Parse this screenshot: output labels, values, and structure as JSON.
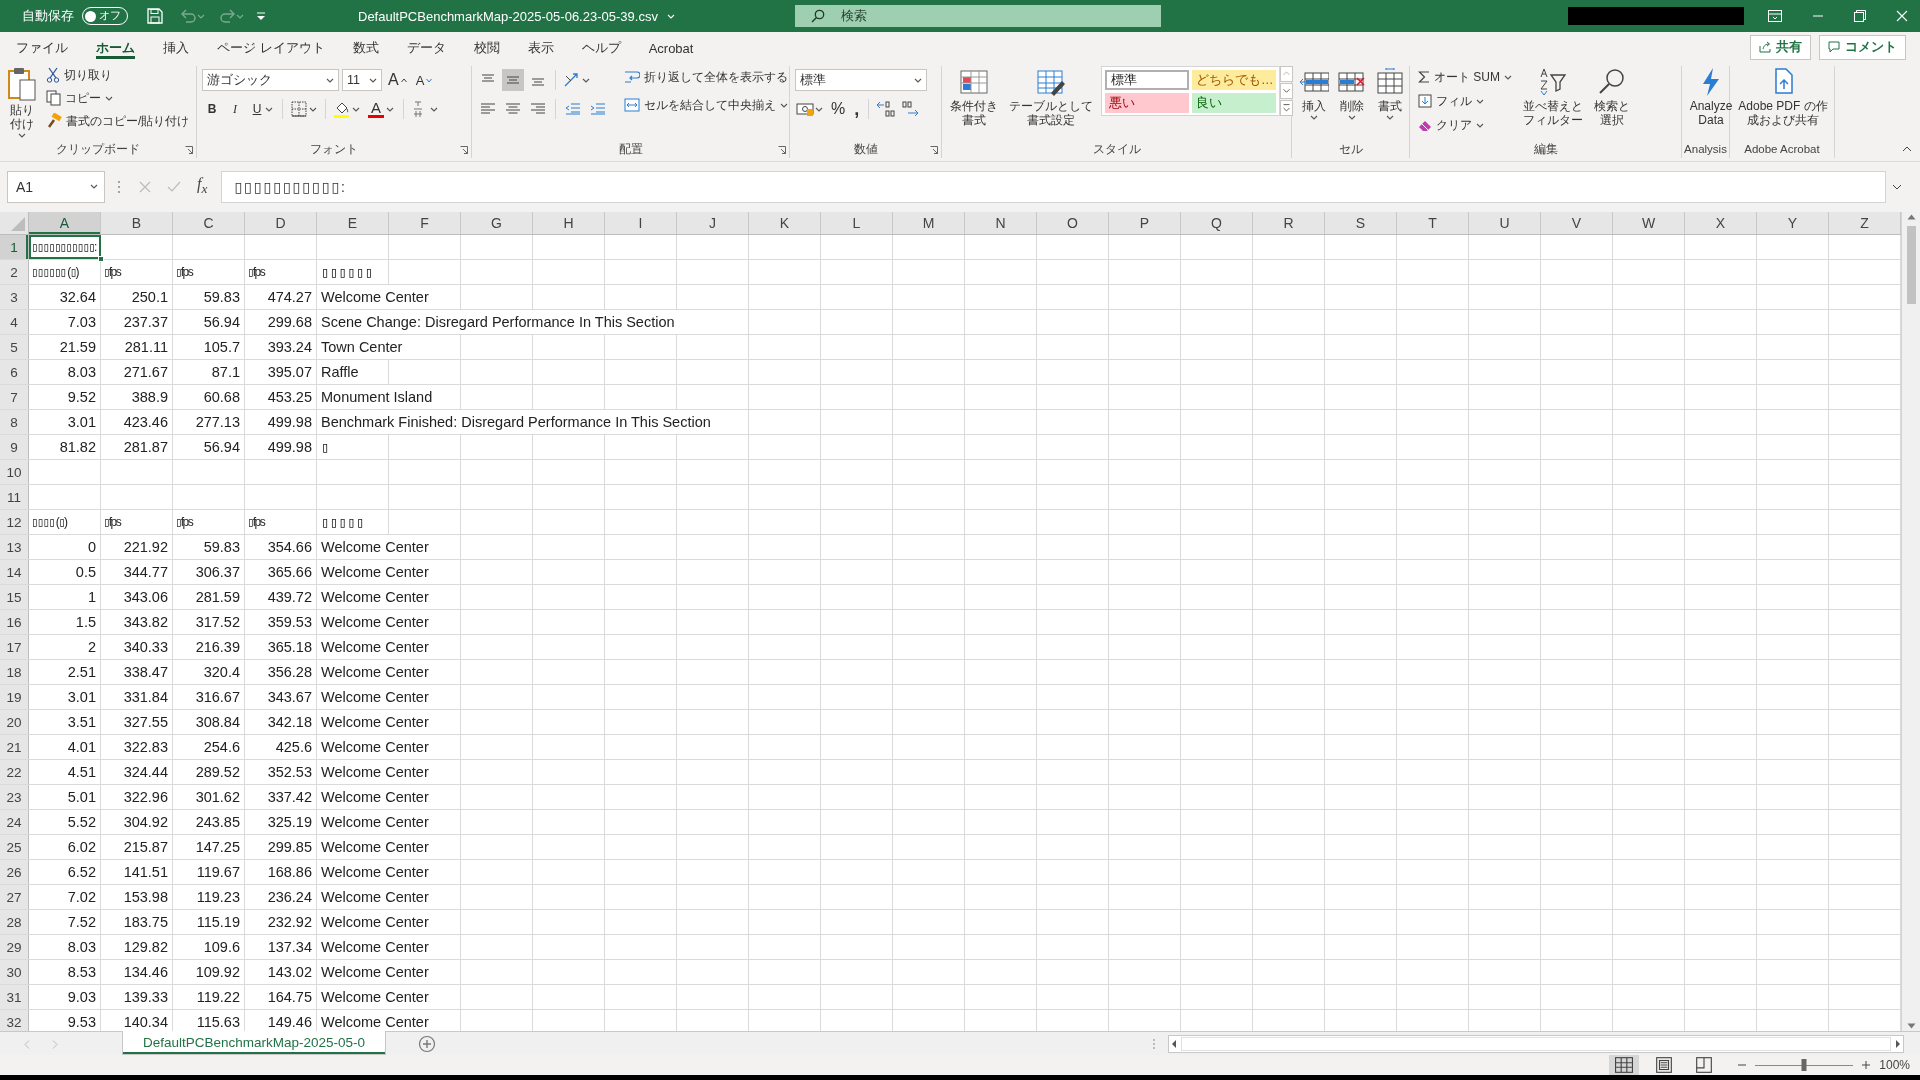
{
  "title_bar": {
    "autosave_label": "自動保存",
    "autosave": {
      "label": "オフ",
      "on": false
    },
    "undo": {
      "disabled": true
    },
    "redo": {
      "disabled": true
    },
    "filename": "DefaultPCBenchmarkMap-2025-05-06.23-05-39.csv",
    "search": {
      "placeholder": "検索"
    }
  },
  "menu_tabs": [
    {
      "label": "ファイル",
      "selected": false
    },
    {
      "label": "ホーム",
      "selected": true
    },
    {
      "label": "挿入",
      "selected": false
    },
    {
      "label": "ページ レイアウト",
      "selected": false
    },
    {
      "label": "数式",
      "selected": false
    },
    {
      "label": "データ",
      "selected": false
    },
    {
      "label": "校閲",
      "selected": false
    },
    {
      "label": "表示",
      "selected": false
    },
    {
      "label": "ヘルプ",
      "selected": false
    },
    {
      "label": "Acrobat",
      "selected": false
    }
  ],
  "share_button": "共有",
  "comment_button": "コメント",
  "ribbon": {
    "clipboard": {
      "paste": "貼り付け",
      "cut": "切り取り",
      "copy": "コピー",
      "format_painter": "書式のコピー/貼り付け",
      "label": "クリップボード"
    },
    "font": {
      "font_name": "游ゴシック",
      "font_size": "11",
      "grow": "A",
      "shrink": "A",
      "bold": "B",
      "italic": "I",
      "underline": "U",
      "font_color": "A",
      "label": "フォント"
    },
    "alignment": {
      "vertical_align": [
        {
          "selected": false
        },
        {
          "selected": true
        },
        {
          "selected": false
        }
      ],
      "wrap_text": "折り返して全体を表示する",
      "merge_center": "セルを結合して中央揃え",
      "label": "配置"
    },
    "number": {
      "format": "標準",
      "percent": "%",
      "comma": ",",
      "label": "数値"
    },
    "styles": {
      "conditional": "条件付き書式",
      "format_table": "テーブルとして書式設定",
      "cell_styles": [
        {
          "label": "標準",
          "kind": "normal"
        },
        {
          "label": "どちらでも…",
          "kind": "neutral"
        },
        {
          "label": "悪い",
          "kind": "bad"
        },
        {
          "label": "良い",
          "kind": "good"
        }
      ],
      "label": "スタイル"
    },
    "cells": {
      "insert": "挿入",
      "delete": "削除",
      "format": "書式",
      "label": "セル"
    },
    "editing": {
      "autosum": "オート SUM",
      "fill": "フィル",
      "clear": "クリア",
      "sort_filter": "並べ替えとフィルター",
      "find_select": "検索と選択",
      "label": "編集"
    },
    "analysis": {
      "analyze_data": "Analyze Data",
      "label": "Analysis"
    },
    "acrobat": {
      "create_share": "Adobe PDF の作成および共有",
      "label": "Adobe Acrobat"
    }
  },
  "formula_bar": {
    "name_box": "A1",
    "function_button": "f$_{x}$",
    "formula": "▯▯▯▯▯▯▯▯▯▯▯:"
  },
  "grid": {
    "columns": [
      {
        "label": "A",
        "selected": true
      },
      {
        "label": "B",
        "selected": false
      },
      {
        "label": "C",
        "selected": false
      },
      {
        "label": "D",
        "selected": false
      },
      {
        "label": "E",
        "selected": false
      },
      {
        "label": "F",
        "selected": false
      },
      {
        "label": "G",
        "selected": false
      },
      {
        "label": "H",
        "selected": false
      },
      {
        "label": "I",
        "selected": false
      },
      {
        "label": "J",
        "selected": false
      },
      {
        "label": "K",
        "selected": false
      },
      {
        "label": "L",
        "selected": false
      },
      {
        "label": "M",
        "selected": false
      },
      {
        "label": "N",
        "selected": false
      },
      {
        "label": "O",
        "selected": false
      },
      {
        "label": "P",
        "selected": false
      },
      {
        "label": "Q",
        "selected": false
      },
      {
        "label": "R",
        "selected": false
      },
      {
        "label": "S",
        "selected": false
      },
      {
        "label": "T",
        "selected": false
      },
      {
        "label": "U",
        "selected": false
      },
      {
        "label": "V",
        "selected": false
      },
      {
        "label": "W",
        "selected": false
      },
      {
        "label": "X",
        "selected": false
      },
      {
        "label": "Y",
        "selected": false
      },
      {
        "label": "Z",
        "selected": false
      }
    ],
    "rows": [
      {
        "number": "1",
        "kind": "label",
        "selected": true,
        "cells": [
          "▯▯▯▯▯▯▯▯▯▯▯:"
        ]
      },
      {
        "number": "2",
        "kind": "label",
        "selected": false,
        "cells": [
          "▯▯▯▯▯▯ (▯)",
          "▯fps",
          "▯fps",
          "▯fps",
          "▯▯▯▯▯▯"
        ]
      },
      {
        "number": "3",
        "kind": "data",
        "selected": false,
        "cells": [
          "32.64",
          "250.1",
          "59.83",
          "474.27",
          "Welcome Center"
        ]
      },
      {
        "number": "4",
        "kind": "data",
        "selected": false,
        "cells": [
          "7.03",
          "237.37",
          "56.94",
          "299.68",
          "Scene Change: Disregard Performance In This Section"
        ]
      },
      {
        "number": "5",
        "kind": "data",
        "selected": false,
        "cells": [
          "21.59",
          "281.11",
          "105.7",
          "393.24",
          "Town Center"
        ]
      },
      {
        "number": "6",
        "kind": "data",
        "selected": false,
        "cells": [
          "8.03",
          "271.67",
          "87.1",
          "395.07",
          "Raffle"
        ]
      },
      {
        "number": "7",
        "kind": "data",
        "selected": false,
        "cells": [
          "9.52",
          "388.9",
          "60.68",
          "453.25",
          "Monument Island"
        ]
      },
      {
        "number": "8",
        "kind": "data",
        "selected": false,
        "cells": [
          "3.01",
          "423.46",
          "277.13",
          "499.98",
          "Benchmark Finished: Disregard Performance In This Section"
        ]
      },
      {
        "number": "9",
        "kind": "data",
        "selected": false,
        "cells": [
          "81.82",
          "281.87",
          "56.94",
          "499.98",
          "▯"
        ]
      },
      {
        "number": "10",
        "kind": "blank",
        "selected": false,
        "cells": []
      },
      {
        "number": "11",
        "kind": "blank",
        "selected": false,
        "cells": []
      },
      {
        "number": "12",
        "kind": "label",
        "selected": false,
        "cells": [
          "▯▯▯▯ (▯)",
          "▯fps",
          "▯fps",
          "▯fps",
          "▯▯▯▯▯"
        ]
      },
      {
        "number": "13",
        "kind": "data",
        "selected": false,
        "cells": [
          "0",
          "221.92",
          "59.83",
          "354.66",
          "Welcome Center"
        ]
      },
      {
        "number": "14",
        "kind": "data",
        "selected": false,
        "cells": [
          "0.5",
          "344.77",
          "306.37",
          "365.66",
          "Welcome Center"
        ]
      },
      {
        "number": "15",
        "kind": "data",
        "selected": false,
        "cells": [
          "1",
          "343.06",
          "281.59",
          "439.72",
          "Welcome Center"
        ]
      },
      {
        "number": "16",
        "kind": "data",
        "selected": false,
        "cells": [
          "1.5",
          "343.82",
          "317.52",
          "359.53",
          "Welcome Center"
        ]
      },
      {
        "number": "17",
        "kind": "data",
        "selected": false,
        "cells": [
          "2",
          "340.33",
          "216.39",
          "365.18",
          "Welcome Center"
        ]
      },
      {
        "number": "18",
        "kind": "data",
        "selected": false,
        "cells": [
          "2.51",
          "338.47",
          "320.4",
          "356.28",
          "Welcome Center"
        ]
      },
      {
        "number": "19",
        "kind": "data",
        "selected": false,
        "cells": [
          "3.01",
          "331.84",
          "316.67",
          "343.67",
          "Welcome Center"
        ]
      },
      {
        "number": "20",
        "kind": "data",
        "selected": false,
        "cells": [
          "3.51",
          "327.55",
          "308.84",
          "342.18",
          "Welcome Center"
        ]
      },
      {
        "number": "21",
        "kind": "data",
        "selected": false,
        "cells": [
          "4.01",
          "322.83",
          "254.6",
          "425.6",
          "Welcome Center"
        ]
      },
      {
        "number": "22",
        "kind": "data",
        "selected": false,
        "cells": [
          "4.51",
          "324.44",
          "289.52",
          "352.53",
          "Welcome Center"
        ]
      },
      {
        "number": "23",
        "kind": "data",
        "selected": false,
        "cells": [
          "5.01",
          "322.96",
          "301.62",
          "337.42",
          "Welcome Center"
        ]
      },
      {
        "number": "24",
        "kind": "data",
        "selected": false,
        "cells": [
          "5.52",
          "304.92",
          "243.85",
          "325.19",
          "Welcome Center"
        ]
      },
      {
        "number": "25",
        "kind": "data",
        "selected": false,
        "cells": [
          "6.02",
          "215.87",
          "147.25",
          "299.85",
          "Welcome Center"
        ]
      },
      {
        "number": "26",
        "kind": "data",
        "selected": false,
        "cells": [
          "6.52",
          "141.51",
          "119.67",
          "168.86",
          "Welcome Center"
        ]
      },
      {
        "number": "27",
        "kind": "data",
        "selected": false,
        "cells": [
          "7.02",
          "153.98",
          "119.23",
          "236.24",
          "Welcome Center"
        ]
      },
      {
        "number": "28",
        "kind": "data",
        "selected": false,
        "cells": [
          "7.52",
          "183.75",
          "115.19",
          "232.92",
          "Welcome Center"
        ]
      },
      {
        "number": "29",
        "kind": "data",
        "selected": false,
        "cells": [
          "8.03",
          "129.82",
          "109.6",
          "137.34",
          "Welcome Center"
        ]
      },
      {
        "number": "30",
        "kind": "data",
        "selected": false,
        "cells": [
          "8.53",
          "134.46",
          "109.92",
          "143.02",
          "Welcome Center"
        ]
      },
      {
        "number": "31",
        "kind": "data",
        "selected": false,
        "cells": [
          "9.03",
          "139.33",
          "119.22",
          "164.75",
          "Welcome Center"
        ]
      },
      {
        "number": "32",
        "kind": "data",
        "selected": false,
        "cells": [
          "9.53",
          "140.34",
          "115.63",
          "149.46",
          "Welcome Center"
        ]
      }
    ]
  },
  "sheet_tabs": [
    {
      "label": "DefaultPCBenchmarkMap-2025-05-0",
      "selected": true
    }
  ],
  "status_bar": {
    "views": [
      {
        "selected": true
      },
      {
        "selected": false
      },
      {
        "selected": false
      }
    ],
    "zoom": {
      "level": 0.5,
      "label": "100%"
    }
  }
}
